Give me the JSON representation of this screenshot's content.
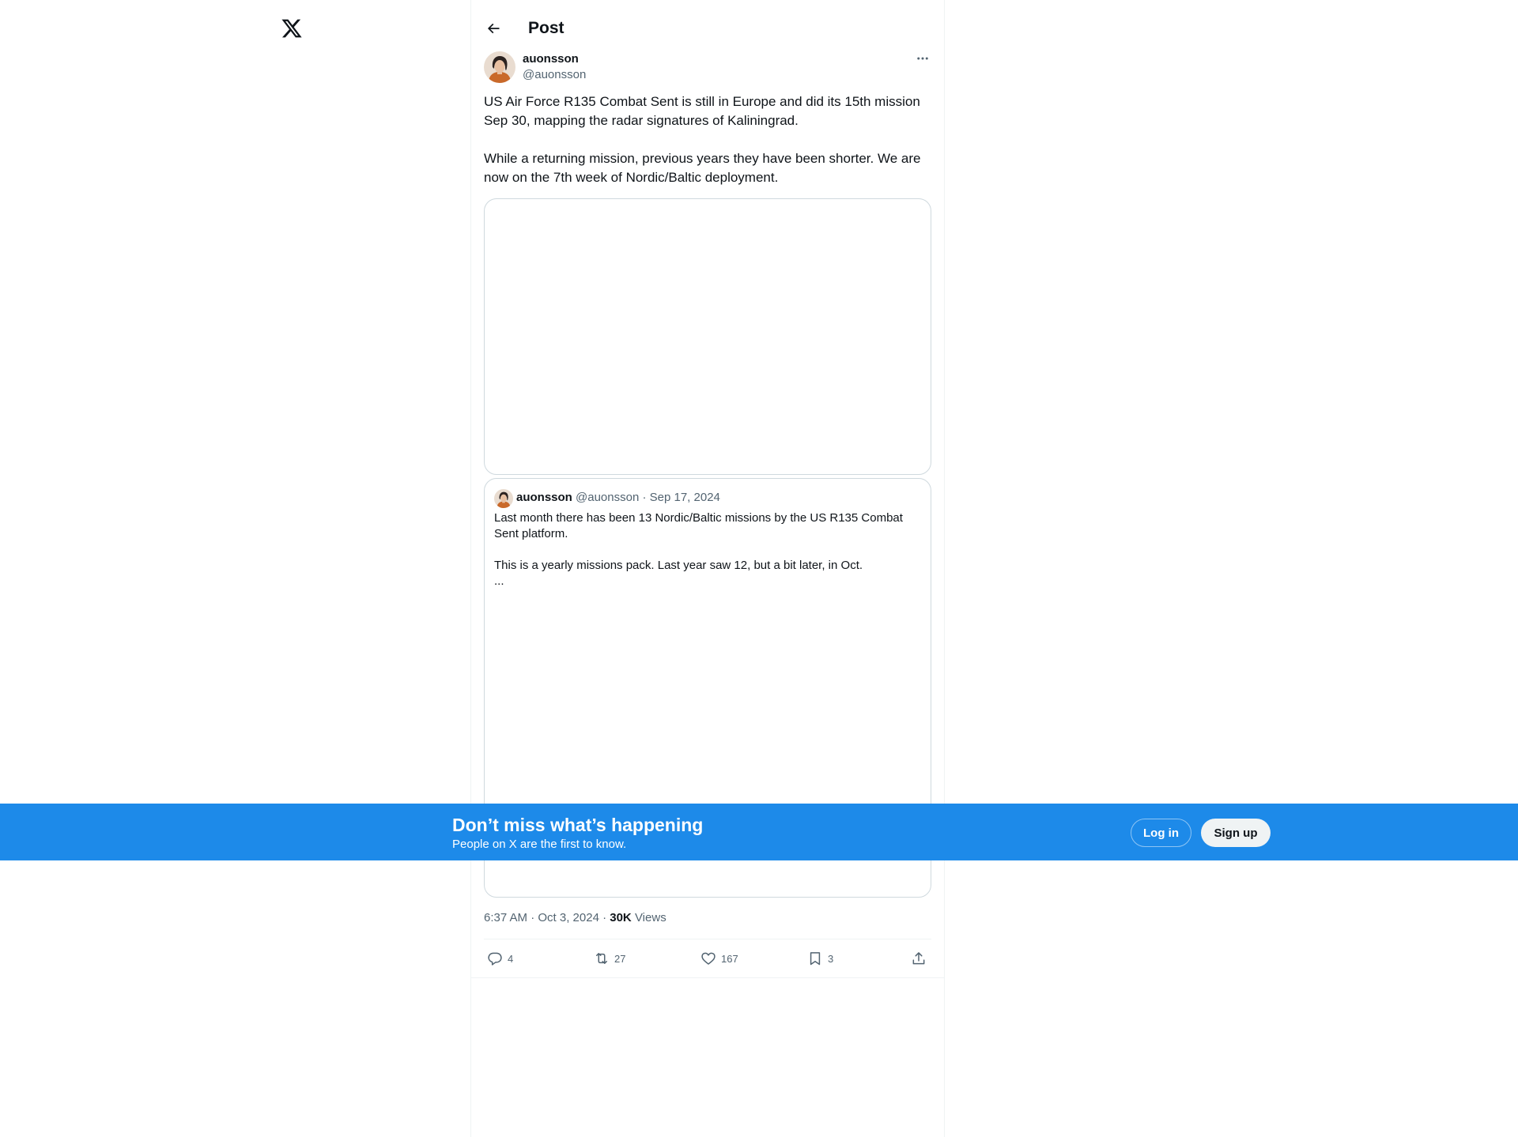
{
  "header": {
    "title": "Post"
  },
  "post": {
    "author_name": "auonsson",
    "author_handle": "@auonsson",
    "paragraphs": [
      "US Air Force R135 Combat Sent is still in Europe and did its 15th mission Sep 30, mapping the radar signatures of Kaliningrad.",
      "While a returning mission, previous years they have been shorter.  We are now on the 7th week of Nordic/Baltic deployment."
    ],
    "timestamp": "6:37 AM · Oct 3, 2024 · ",
    "views_count": "30K",
    "views_label": " Views"
  },
  "quote": {
    "author_name": "auonsson",
    "author_handle": "@auonsson",
    "separator": " · ",
    "date": "Sep 17, 2024",
    "paragraphs": [
      "Last month there has been 13 Nordic/Baltic missions by the US R135 Combat Sent platform.",
      "This is a yearly missions pack. Last year saw 12, but a bit later, in Oct.",
      "..."
    ]
  },
  "actions": {
    "replies": "4",
    "reposts": "27",
    "likes": "167",
    "bookmarks": "3"
  },
  "banner": {
    "title": "Don’t miss what’s happening",
    "subtitle": "People on X are the first to know.",
    "login_label": "Log in",
    "signup_label": "Sign up"
  },
  "icons": {
    "logo": "x-logo-icon",
    "back": "arrow-left-icon",
    "more": "more-horizontal-icon",
    "reply": "reply-icon",
    "repost": "repost-icon",
    "like": "heart-icon",
    "bookmark": "bookmark-icon",
    "share": "share-icon"
  },
  "colors": {
    "accent": "#1d8ae9",
    "text_primary": "#0f1419",
    "text_secondary": "#536471",
    "border": "#cfd9de"
  }
}
